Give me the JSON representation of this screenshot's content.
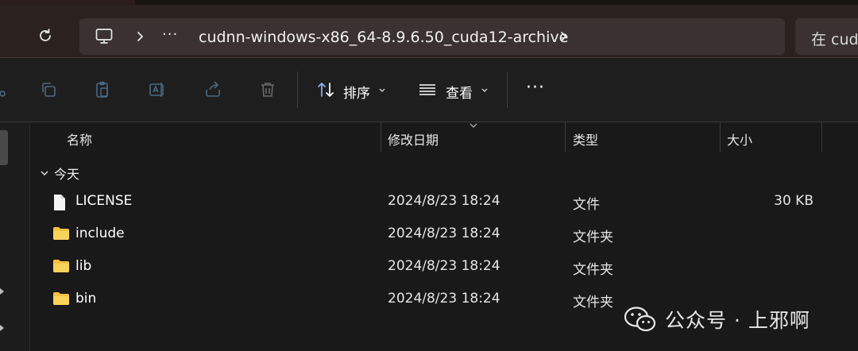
{
  "address": {
    "ellipsis": "···",
    "breadcrumb": "cudnn-windows-x86_64-8.9.6.50_cuda12-archive"
  },
  "search": {
    "placeholder": "在 cudnn"
  },
  "toolbar": {
    "sort_label": "排序",
    "view_label": "查看",
    "more_label": "···"
  },
  "columns": {
    "name": "名称",
    "date": "修改日期",
    "type": "类型",
    "size": "大小"
  },
  "group": {
    "label": "今天"
  },
  "files": [
    {
      "name": "LICENSE",
      "date": "2024/8/23 18:24",
      "type": "文件",
      "size": "30 KB",
      "icon": "document-icon"
    },
    {
      "name": "include",
      "date": "2024/8/23 18:24",
      "type": "文件夹",
      "size": "",
      "icon": "folder-icon"
    },
    {
      "name": "lib",
      "date": "2024/8/23 18:24",
      "type": "文件夹",
      "size": "",
      "icon": "folder-icon"
    },
    {
      "name": "bin",
      "date": "2024/8/23 18:24",
      "type": "文件夹",
      "size": "",
      "icon": "folder-icon"
    }
  ],
  "watermark": {
    "text": "公众号 · 上邪啊"
  },
  "colors": {
    "folder": "#f5c242",
    "background": "#191919",
    "address_bg": "#3a3130"
  }
}
